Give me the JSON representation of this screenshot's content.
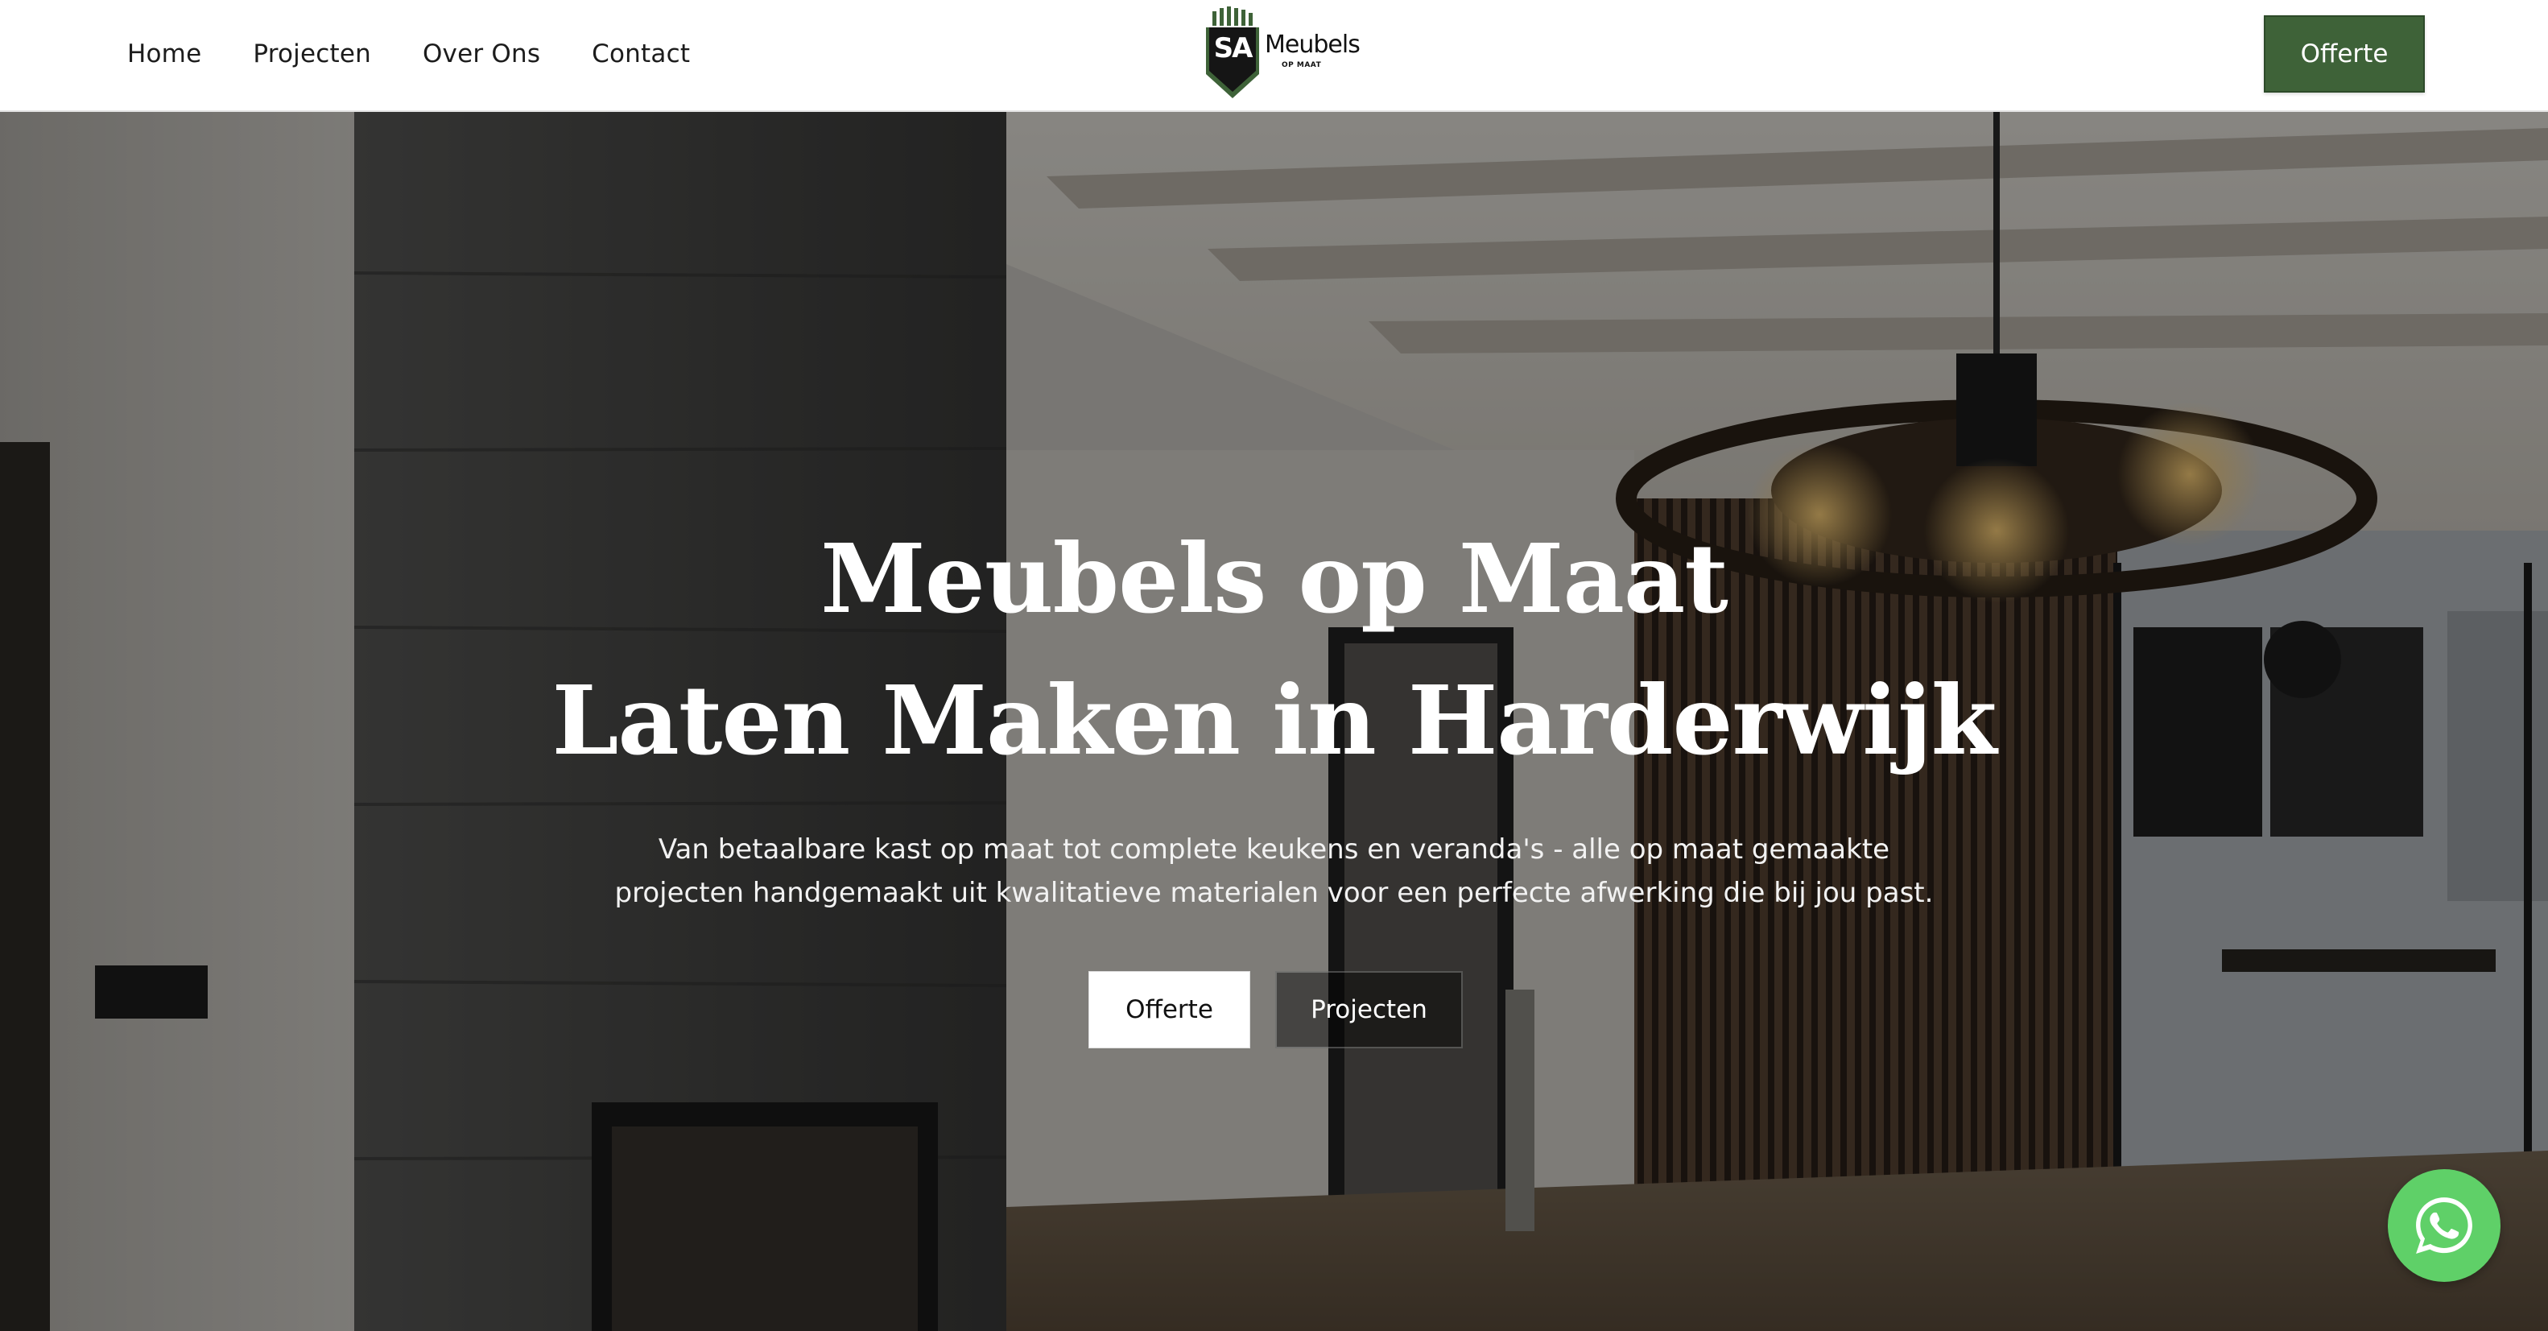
{
  "header": {
    "nav": [
      {
        "label": "Home"
      },
      {
        "label": "Projecten"
      },
      {
        "label": "Over Ons"
      },
      {
        "label": "Contact"
      }
    ],
    "logo": {
      "initials": "SA",
      "word": "Meubels",
      "sub": "OP MAAT"
    },
    "cta_label": "Offerte"
  },
  "hero": {
    "title_line1": "Meubels op Maat",
    "title_line2": "Laten Maken in Harderwijk",
    "text_line1": "Van betaalbare kast op maat tot complete keukens en veranda's - alle op maat gemaakte",
    "text_line2": "projecten handgemaakt uit kwalitatieve materialen voor een perfecte afwerking die bij jou past.",
    "buttons": {
      "primary": "Offerte",
      "secondary": "Projecten"
    }
  },
  "colors": {
    "brand_green": "#3e6238",
    "whatsapp_green": "#5fd068",
    "text_dark": "#1c1c1c"
  },
  "icons": {
    "logo": "sa-shield-logo",
    "whatsapp": "whatsapp-icon"
  }
}
